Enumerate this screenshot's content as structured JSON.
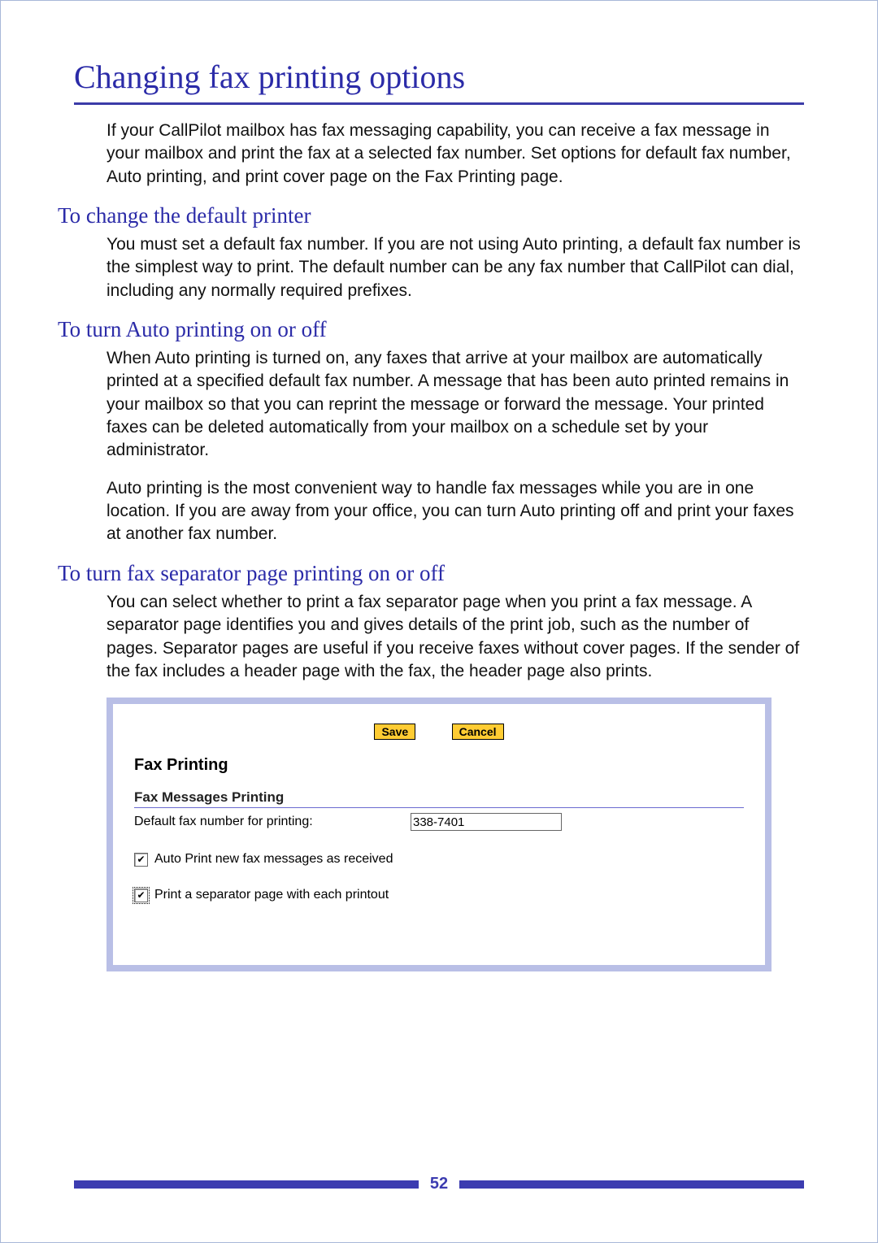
{
  "title": "Changing fax printing options",
  "intro": "If your CallPilot mailbox has fax messaging capability, you can receive a fax message in your mailbox and print the fax at a selected fax number. Set options for default fax number, Auto printing, and print cover page on the Fax Printing page.",
  "sections": {
    "s1": {
      "heading": "To change the default printer",
      "p1": "You must set a default fax number. If you are not using Auto printing, a default fax number is the simplest way to print. The default number can be any fax number that CallPilot can dial, including any normally required prefixes."
    },
    "s2": {
      "heading": "To turn Auto printing on or off",
      "p1": "When Auto printing is turned on, any faxes that arrive at your mailbox are automatically printed at a specified default fax number. A message that has been auto printed remains in your mailbox so that you can reprint the message or forward the message. Your printed faxes can be deleted automatically from your mailbox on a schedule set by your administrator.",
      "p2": "Auto printing is the most convenient way to handle fax messages while you are in one location. If you are away from your office, you can turn Auto printing off and print your faxes at another fax number."
    },
    "s3": {
      "heading": "To turn fax separator page printing on or off",
      "p1": "You can select whether to print a fax separator page when you print a fax message. A separator page identifies you and gives details of the print job, such as the number of pages. Separator pages are useful if you receive faxes without cover pages. If the sender of the fax includes a header page with the fax, the header page also prints."
    }
  },
  "panel": {
    "save": "Save",
    "cancel": "Cancel",
    "title": "Fax Printing",
    "section_label": "Fax Messages Printing",
    "default_label": "Default fax number for printing:",
    "default_value": "338-7401",
    "autoprint_label": "Auto Print new fax messages as received",
    "separator_label": "Print a separator page with each printout",
    "checkmark": "✔"
  },
  "page_number": "52"
}
